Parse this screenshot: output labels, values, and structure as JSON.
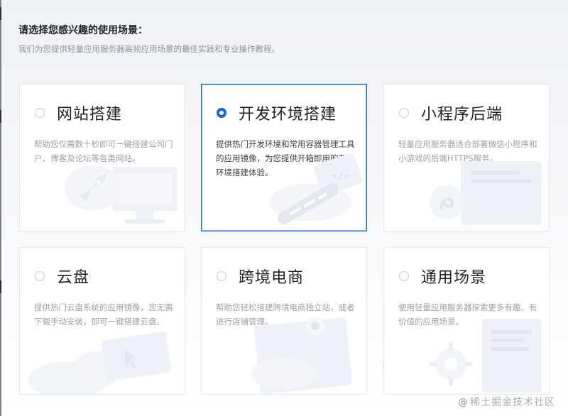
{
  "header": {
    "title": "请选择您感兴趣的使用场景：",
    "subtitle": "我们为您提供轻量应用服务器高频应用场景的最佳实践和专业操作教程。"
  },
  "scenarios": [
    {
      "title": "网站搭建",
      "description": "帮助您仅需数十秒即可一键搭建公司门户、博客及论坛等各类网站。",
      "selected": false,
      "icon": "rocket-monitor-illustration"
    },
    {
      "title": "开发环境搭建",
      "description": "提供热门开发环境和常用容器管理工具的应用镜像，为您提供开箱即用的开发环境搭建体验。",
      "selected": true,
      "icon": "code-brackets-illustration"
    },
    {
      "title": "小程序后端",
      "description": "轻量应用服务器适合部署微信小程序和小游戏的后端HTTPS服务。",
      "selected": false,
      "icon": "miniprogram-window-illustration"
    },
    {
      "title": "云盘",
      "description": "提供热门云盘系统的应用镜像，您无需下载手动安装，即可一键搭建云盘。",
      "selected": false,
      "icon": "cloud-cursor-illustration"
    },
    {
      "title": "跨境电商",
      "description": "帮助您轻松搭建跨境电商独立站，或者进行店铺管理。",
      "selected": false,
      "icon": "ecommerce-window-illustration"
    },
    {
      "title": "通用场景",
      "description": "使用轻量应用服务器探索更多有趣、有价值的应用场景。",
      "selected": false,
      "icon": "gear-document-illustration"
    }
  ],
  "watermark": {
    "at": "@",
    "text": "稀土掘金技术社区"
  },
  "colors": {
    "accent": "#1769d9",
    "title": "#1f2329",
    "muted": "#9aa0a8",
    "border": "#e3e6eb"
  }
}
